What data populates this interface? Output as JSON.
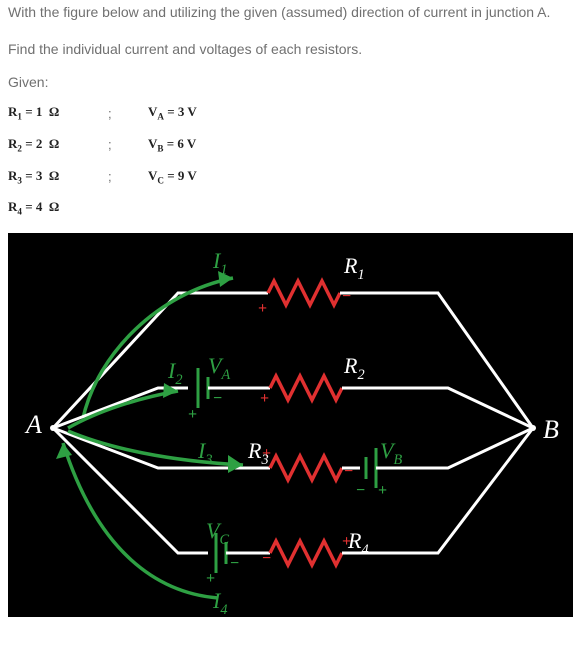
{
  "instruction_line1": "With the figure below and utilizing the given (assumed) direction of current in junction A.",
  "instruction_line2": "Find the individual current and voltages of each resistors.",
  "given_label": "Given:",
  "given": [
    {
      "left_html": "R<span class='sub'>1</span> = 1&nbsp;&nbsp;&Omega;",
      "sep": ";",
      "right_html": "V<span class='sub'>A</span> = 3 V"
    },
    {
      "left_html": "R<span class='sub'>2</span> = 2&nbsp;&nbsp;&Omega;",
      "sep": ";",
      "right_html": "V<span class='sub'>B</span> = 6 V"
    },
    {
      "left_html": "R<span class='sub'>3</span> = 3&nbsp;&nbsp;&Omega;",
      "sep": ";",
      "right_html": "V<span class='sub'>C</span> = 9 V"
    },
    {
      "left_html": "R<span class='sub'>4</span> = 4&nbsp;&nbsp;&Omega;",
      "sep": "",
      "right_html": ""
    }
  ],
  "nodes": {
    "A": "A",
    "B": "B"
  },
  "resistors": {
    "R1": "R",
    "R2": "R",
    "R3": "R",
    "R4": "R"
  },
  "resistor_subs": {
    "R1": "1",
    "R2": "2",
    "R3": "3",
    "R4": "4"
  },
  "currents": {
    "I1": "I",
    "I2": "I",
    "I3": "I",
    "I4": "I"
  },
  "current_subs": {
    "I1": "1",
    "I2": "2",
    "I3": "3",
    "I4": "4"
  },
  "sources": {
    "VA": "V",
    "VB": "V",
    "VC": "V"
  },
  "source_subs": {
    "VA": "A",
    "VB": "B",
    "VC": "C"
  },
  "chart_data": {
    "type": "table",
    "description": "Parallel resistor network between junctions A and B with four branches",
    "branches": [
      {
        "id": 1,
        "components": [
          "R1"
        ],
        "current": "I1",
        "direction": "A_to_B"
      },
      {
        "id": 2,
        "components": [
          "VA",
          "R2"
        ],
        "current": "I2",
        "direction": "A_to_B"
      },
      {
        "id": 3,
        "components": [
          "R3",
          "VB"
        ],
        "current": "I3",
        "direction": "A_to_B"
      },
      {
        "id": 4,
        "components": [
          "VC",
          "R4"
        ],
        "current": "I4",
        "direction": "B_to_A"
      }
    ],
    "resistances_ohm": {
      "R1": 1,
      "R2": 2,
      "R3": 3,
      "R4": 4
    },
    "voltages_v": {
      "VA": 3,
      "VB": 6,
      "VC": 9
    }
  }
}
